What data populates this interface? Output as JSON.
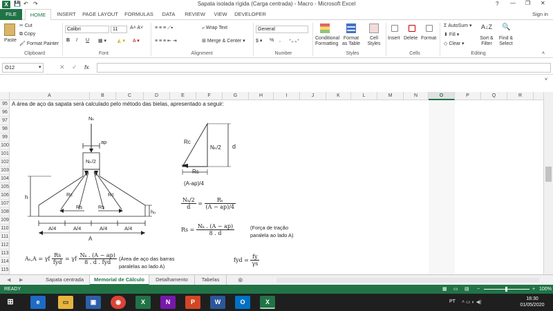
{
  "window": {
    "title": "Sapata isolada rígida (Carga centrada) - Macro - Microsoft Excel",
    "help": "?",
    "signin": "Sign in"
  },
  "tabs": [
    "FILE",
    "HOME",
    "INSERT",
    "PAGE LAYOUT",
    "FORMULAS",
    "DATA",
    "REVIEW",
    "VIEW",
    "DEVELOPER"
  ],
  "ribbon": {
    "clipboard": {
      "paste": "Paste",
      "cut": "Cut",
      "copy": "Copy",
      "format_painter": "Format Painter",
      "group": "Clipboard"
    },
    "font": {
      "name": "Calibri",
      "size": "11",
      "group": "Font",
      "bold": "B",
      "italic": "I",
      "underline": "U"
    },
    "alignment": {
      "wrap": "Wrap Text",
      "merge": "Merge & Center",
      "group": "Alignment"
    },
    "number": {
      "format": "General",
      "group": "Number",
      "percent": "%",
      "comma": ","
    },
    "styles": {
      "conditional": "Conditional Formatting",
      "table": "Format as Table",
      "cell": "Cell Styles",
      "group": "Styles"
    },
    "cells": {
      "insert": "Insert",
      "delete": "Delete",
      "format": "Format",
      "group": "Cells"
    },
    "editing": {
      "autosum": "AutoSum",
      "fill": "Fill",
      "clear": "Clear",
      "sort": "Sort & Filter",
      "find": "Find & Select",
      "group": "Editing"
    }
  },
  "formula_bar": {
    "name_box": "O12",
    "fx": "fx",
    "value": ""
  },
  "columns": [
    "A",
    "B",
    "C",
    "D",
    "E",
    "F",
    "G",
    "H",
    "I",
    "J",
    "K",
    "L",
    "M",
    "N",
    "O",
    "P",
    "Q",
    "R"
  ],
  "selected_column": "O",
  "rows": [
    "95",
    "96",
    "97",
    "98",
    "99",
    "100",
    "101",
    "102",
    "103",
    "104",
    "105",
    "106",
    "107",
    "108",
    "109",
    "110",
    "111",
    "112",
    "113",
    "114",
    "115"
  ],
  "sheet": {
    "row95_text": "A área de aço da sapata será calculado pelo método das bielas, apresentado a seguir:",
    "diagram": {
      "nk": "Nₖ",
      "ap": "ap",
      "nk2": "Nₖ/2",
      "h": "h",
      "rc": "Rc",
      "rs": "Rs",
      "h0": "h₀",
      "a4": "A/4",
      "a": "A",
      "tri_rc": "Rc",
      "tri_nk2": "Nₖ/2",
      "tri_d": "d",
      "tri_rs": "Rs",
      "tri_aap": "(A-ap)/4"
    },
    "eq1": {
      "lhs_n": "Nₖ/2",
      "lhs_d": "d",
      "rhs_n": "Rₛ",
      "rhs_d": "(A − ap)/4"
    },
    "eq2": {
      "lhs": "Rs =",
      "num": "Nₖ . (A − ap)",
      "den": "8 . d",
      "note1": "(Força de tração",
      "note2": "paralela ao lado A)"
    },
    "eq3": {
      "lhs": "Aₛ,A = γf",
      "f1n": "Rs",
      "f1d": "fyd",
      "mid": "= γf",
      "f2n": "Nₖ . (A − ap)",
      "f2d": "8 . d . fyd",
      "note1": "(Área de aço das barras",
      "note2": "paralelas ao lado A)"
    },
    "eq4": {
      "lhs": "fyd =",
      "n": "fy",
      "d": "γs"
    }
  },
  "sheet_tabs": [
    "Sapata centrada",
    "Memorial de Cálculo",
    "Detalhamento",
    "Tabelas"
  ],
  "active_sheet": "Memorial de Cálculo",
  "status": {
    "ready": "READY",
    "zoom": "100%"
  },
  "taskbar": {
    "lang": "PT",
    "time": "18:30",
    "date": "01/05/2020"
  },
  "colors": {
    "excel_green": "#217346"
  }
}
